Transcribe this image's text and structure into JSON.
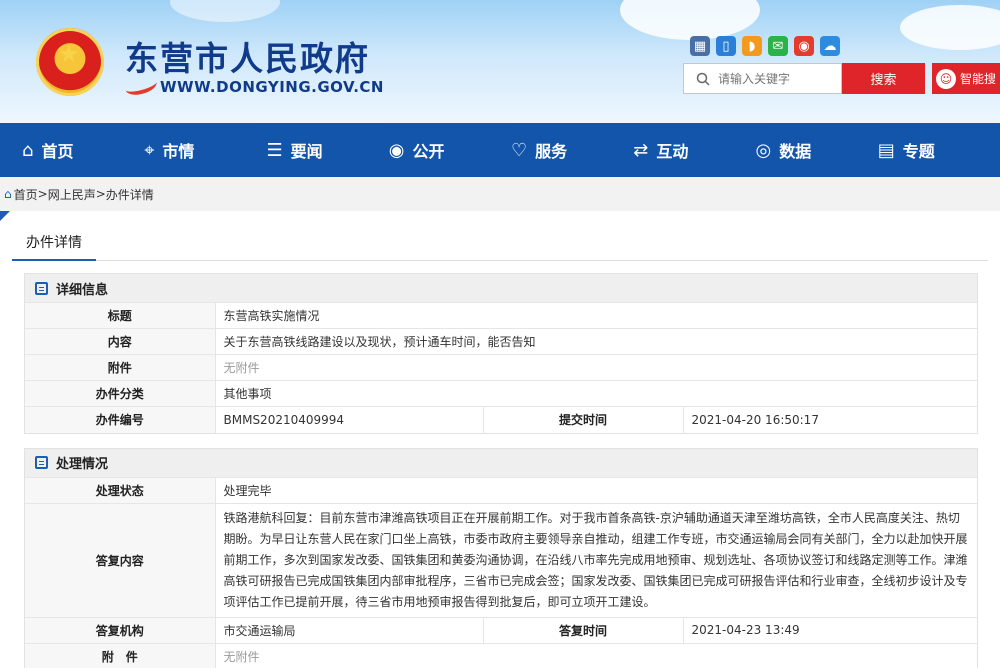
{
  "header": {
    "site_title": "东营市人民政府",
    "site_domain": "WWW.DONGYING.GOV.CN",
    "search_placeholder": "请输入关键字",
    "search_button": "搜索",
    "robot_button": "智能搜"
  },
  "nav": {
    "items": [
      {
        "label": "首页",
        "icon": "home-icon"
      },
      {
        "label": "市情",
        "icon": "city-info-icon"
      },
      {
        "label": "要闻",
        "icon": "list-icon"
      },
      {
        "label": "公开",
        "icon": "eye-icon"
      },
      {
        "label": "服务",
        "icon": "heart-icon"
      },
      {
        "label": "互动",
        "icon": "interact-icon"
      },
      {
        "label": "数据",
        "icon": "data-icon"
      },
      {
        "label": "专题",
        "icon": "topic-icon"
      }
    ]
  },
  "breadcrumb": {
    "home": "首页",
    "level1": "网上民声",
    "level2": "办件详情",
    "sep": ">"
  },
  "page_tab": "办件详情",
  "detail": {
    "title": "详细信息",
    "rows": {
      "title_label": "标题",
      "title_value": "东营高铁实施情况",
      "content_label": "内容",
      "content_value": "关于东营高铁线路建设以及现状，预计通车时间，能否告知",
      "attach_label": "附件",
      "attach_value": "无附件",
      "category_label": "办件分类",
      "category_value": "其他事项",
      "number_label": "办件编号",
      "number_value": "BMMS20210409994",
      "submit_label": "提交时间",
      "submit_value": "2021-04-20 16:50:17"
    }
  },
  "handling": {
    "title": "处理情况",
    "rows": {
      "status_label": "处理状态",
      "status_value": "处理完毕",
      "reply_label": "答复内容",
      "reply_value": "铁路港航科回复：目前东营市津潍高铁项目正在开展前期工作。对于我市首条高铁-京沪辅助通道天津至潍坊高铁，全市人民高度关注、热切期盼。为早日让东营人民在家门口坐上高铁，市委市政府主要领导亲自推动，组建工作专班，市交通运输局会同有关部门，全力以赴加快开展前期工作，多次到国家发改委、国铁集团和黄委沟通协调，在沿线八市率先完成用地预审、规划选址、各项协议签订和线路定测等工作。津潍高铁可研报告已完成国铁集团内部审批程序，三省市已完成会签；国家发改委、国铁集团已完成可研报告评估和行业审查，全线初步设计及专项评估工作已提前开展，待三省市用地预审报告得到批复后，即可立项开工建设。",
      "org_label": "答复机构",
      "org_value": "市交通运输局",
      "time_label": "答复时间",
      "time_value": "2021-04-23 13:49",
      "attach_label": "附　件",
      "attach_value": "无附件"
    }
  }
}
